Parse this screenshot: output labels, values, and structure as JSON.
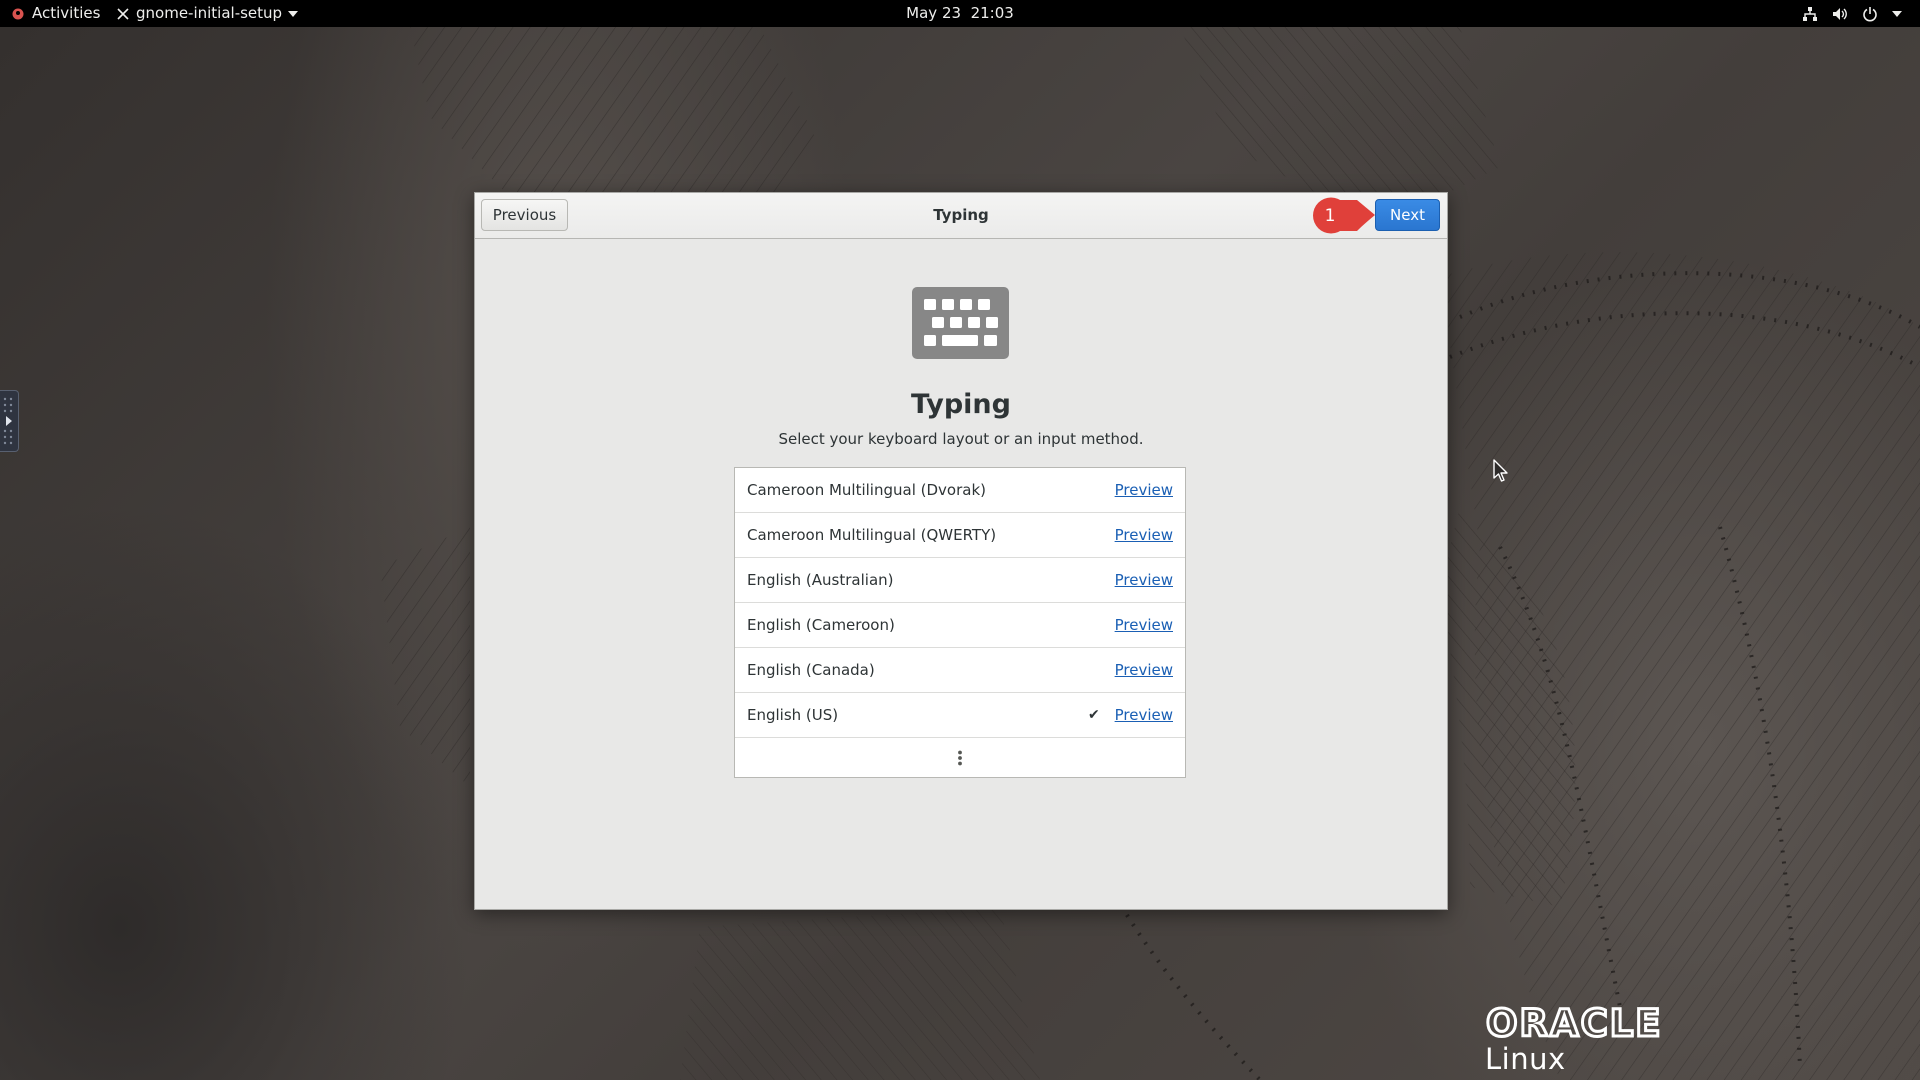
{
  "topbar": {
    "activities_label": "Activities",
    "app_name": "gnome-initial-setup",
    "clock": "May 23  21:03",
    "tray_icons": [
      "network-icon",
      "volume-icon",
      "power-icon",
      "chevron-down-icon"
    ]
  },
  "dialog": {
    "title": "Typing",
    "previous_label": "Previous",
    "next_label": "Next",
    "annotation_number": "1",
    "heading": "Typing",
    "subtitle": "Select your keyboard layout or an input method.",
    "icon": "keyboard-icon",
    "layouts": [
      {
        "name": "Cameroon Multilingual (Dvorak)",
        "selected": false,
        "preview": "Preview"
      },
      {
        "name": "Cameroon Multilingual (QWERTY)",
        "selected": false,
        "preview": "Preview"
      },
      {
        "name": "English (Australian)",
        "selected": false,
        "preview": "Preview"
      },
      {
        "name": "English (Cameroon)",
        "selected": false,
        "preview": "Preview"
      },
      {
        "name": "English (Canada)",
        "selected": false,
        "preview": "Preview"
      },
      {
        "name": "English (US)",
        "selected": true,
        "check": "✔",
        "preview": "Preview"
      }
    ],
    "more_icon": "more-vertical-icon"
  },
  "branding": {
    "logo_text": "ORACLE",
    "sub_text": "Linux"
  },
  "colors": {
    "accent": "#3584e4",
    "link": "#1a5fb4",
    "annotation": "#e0403a"
  }
}
